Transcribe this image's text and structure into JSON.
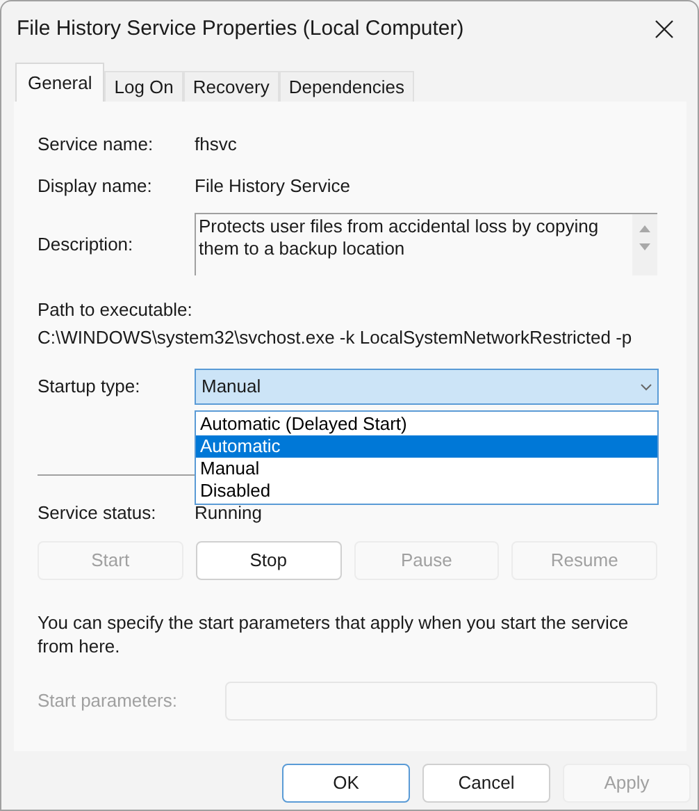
{
  "window": {
    "title": "File History Service Properties (Local Computer)"
  },
  "tabs": [
    {
      "label": "General",
      "selected": true
    },
    {
      "label": "Log On",
      "selected": false
    },
    {
      "label": "Recovery",
      "selected": false
    },
    {
      "label": "Dependencies",
      "selected": false
    }
  ],
  "service_name": {
    "label": "Service name:",
    "value": "fhsvc"
  },
  "display_name": {
    "label": "Display name:",
    "value": "File History Service"
  },
  "description": {
    "label": "Description:",
    "value": "Protects user files from accidental loss by copying them to a backup location"
  },
  "path": {
    "label": "Path to executable:",
    "value": "C:\\WINDOWS\\system32\\svchost.exe -k LocalSystemNetworkRestricted -p"
  },
  "startup_type": {
    "label": "Startup type:",
    "value": "Manual",
    "expanded": true,
    "options": [
      {
        "label": "Automatic (Delayed Start)",
        "highlighted": false
      },
      {
        "label": "Automatic",
        "highlighted": true
      },
      {
        "label": "Manual",
        "highlighted": false
      },
      {
        "label": "Disabled",
        "highlighted": false
      }
    ]
  },
  "service_status": {
    "label": "Service status:",
    "value": "Running"
  },
  "service_buttons": [
    {
      "label": "Start",
      "disabled": true
    },
    {
      "label": "Stop",
      "disabled": false
    },
    {
      "label": "Pause",
      "disabled": true
    },
    {
      "label": "Resume",
      "disabled": true
    }
  ],
  "note": "You can specify the start parameters that apply when you start the service from here.",
  "start_parameters": {
    "label": "Start parameters:",
    "disabled": true
  },
  "dialog_buttons": [
    {
      "label": "OK",
      "disabled": false,
      "default": true
    },
    {
      "label": "Cancel",
      "disabled": false,
      "default": false
    },
    {
      "label": "Apply",
      "disabled": true,
      "default": false
    }
  ]
}
